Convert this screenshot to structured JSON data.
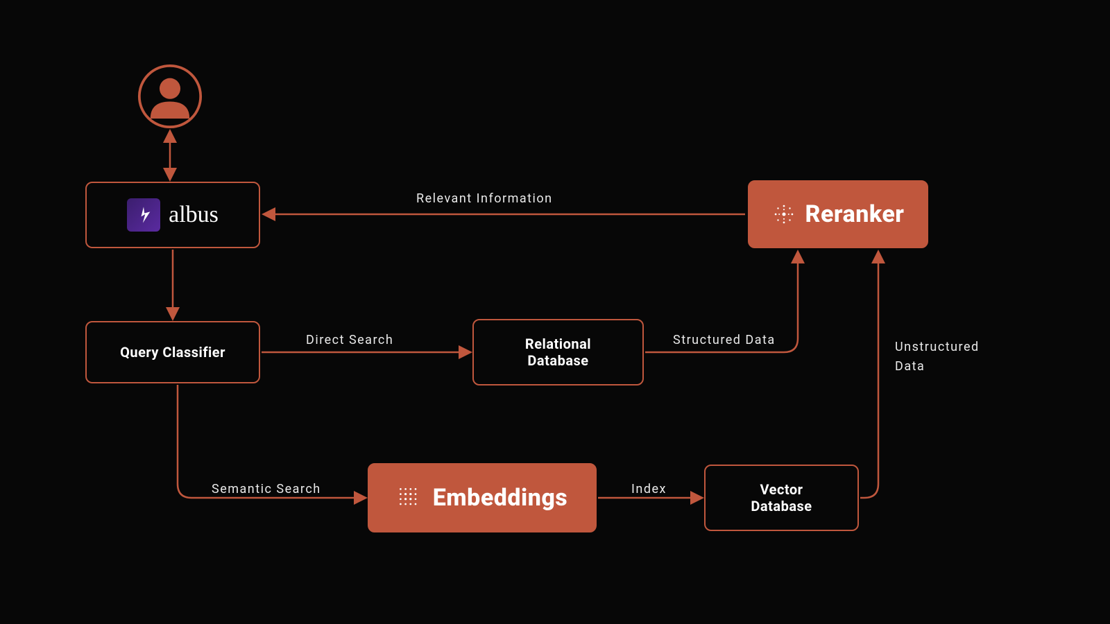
{
  "colors": {
    "accent": "#c0573d",
    "bg": "#070707",
    "text": "#ffffff",
    "label": "#e9e9e9"
  },
  "nodes": {
    "user": {
      "name": "user"
    },
    "albus": {
      "label": "albus"
    },
    "classifier": {
      "label": "Query Classifier"
    },
    "relational": {
      "label_l1": "Relational",
      "label_l2": "Database"
    },
    "reranker": {
      "label": "Reranker"
    },
    "embeddings": {
      "label": "Embeddings"
    },
    "vector": {
      "label_l1": "Vector",
      "label_l2": "Database"
    }
  },
  "edges": {
    "relevant": "Relevant Information",
    "direct": "Direct Search",
    "structured": "Structured Data",
    "unstructured1": "Unstructured",
    "unstructured2": "Data",
    "semantic": "Semantic Search",
    "index": "Index"
  },
  "diagram": {
    "flow": [
      "user <-> albus",
      "albus -> classifier",
      "classifier --Direct Search--> relational",
      "classifier --Semantic Search--> embeddings",
      "relational --Structured Data--> reranker",
      "embeddings --Index--> vector",
      "vector --Unstructured Data--> reranker",
      "reranker --Relevant Information--> albus"
    ]
  }
}
